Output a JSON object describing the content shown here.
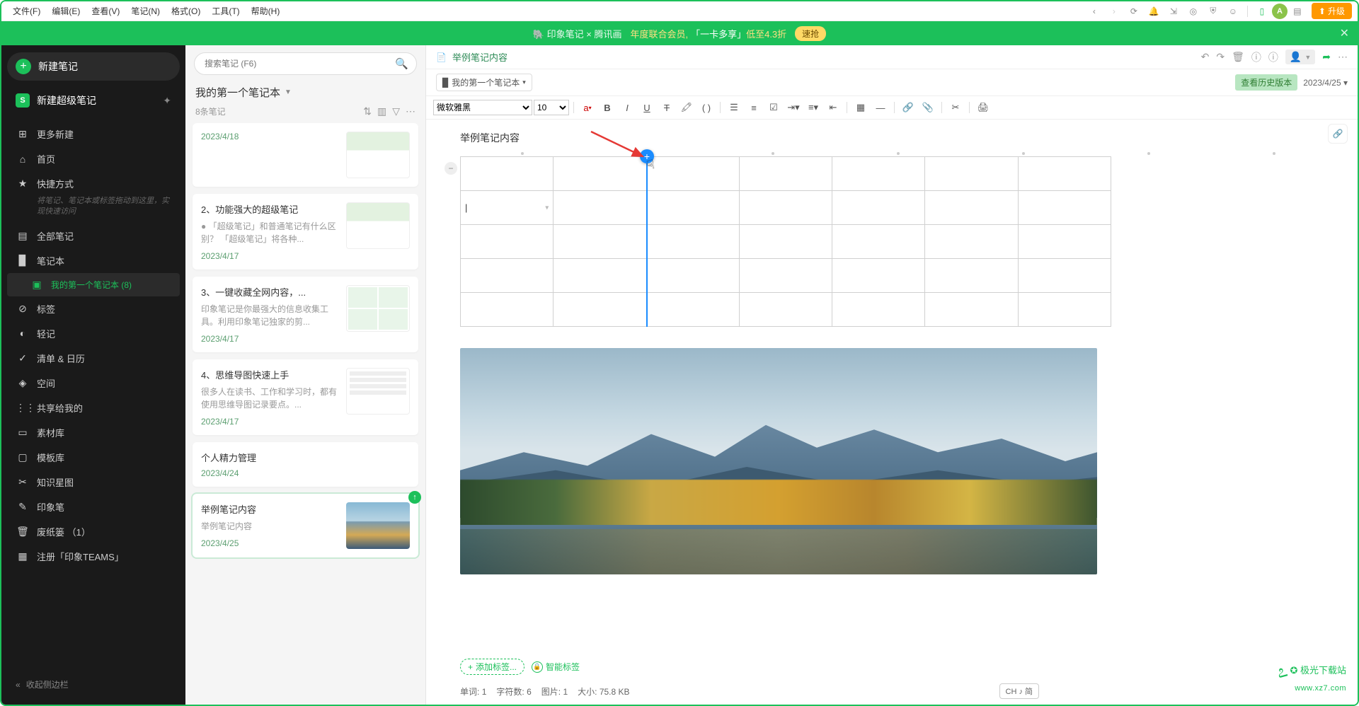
{
  "menubar": {
    "items": [
      "文件(F)",
      "编辑(E)",
      "查看(V)",
      "笔记(N)",
      "格式(O)",
      "工具(T)",
      "帮助(H)"
    ],
    "avatar_letter": "A",
    "upgrade_label": "升级"
  },
  "banner": {
    "logo_text": "印象笔记 × 腾讯画",
    "text1": "年度联合会员,",
    "text2": "「一卡多享」",
    "text3": "低至4.3折",
    "grab_label": "速抢"
  },
  "sidebar": {
    "new_note": "新建笔记",
    "new_super": "新建超级笔记",
    "items": [
      {
        "icon": "⊞",
        "label": "更多新建"
      },
      {
        "icon": "⌂",
        "label": "首页"
      },
      {
        "icon": "★",
        "label": "快捷方式",
        "subtext": "将笔记、笔记本或标签拖动到这里，实现快速访问"
      },
      {
        "icon": "▤",
        "label": "全部笔记"
      },
      {
        "icon": "▉",
        "label": "笔记本"
      },
      {
        "icon": "▣",
        "label": "我的第一个笔记本  (8)",
        "indent": true,
        "active": true
      },
      {
        "icon": "⊘",
        "label": "标签"
      },
      {
        "icon": "◐",
        "label": "轻记"
      },
      {
        "icon": "✓",
        "label": "清单 & 日历"
      },
      {
        "icon": "◈",
        "label": "空间"
      },
      {
        "icon": "⋮⋮",
        "label": "共享给我的"
      },
      {
        "icon": "▭",
        "label": "素材库"
      },
      {
        "icon": "▢",
        "label": "模板库"
      },
      {
        "icon": "✂",
        "label": "知识星图"
      },
      {
        "icon": "✎",
        "label": "印象笔"
      },
      {
        "icon": "🗑",
        "label": "废纸篓 （1）"
      },
      {
        "icon": "▦",
        "label": "注册「印象TEAMS」"
      }
    ],
    "collapse": "收起侧边栏"
  },
  "notelist": {
    "search_placeholder": "搜索笔记 (F6)",
    "notebook_title": "我的第一个笔记本",
    "count_label": "8条笔记",
    "cards": [
      {
        "title": "",
        "snippet": "",
        "date": "2023/4/18",
        "thumb": "app"
      },
      {
        "title": "2、功能强大的超级笔记",
        "snippet": "● 「超级笔记」和普通笔记有什么区别？ 「超级笔记」将各种...",
        "date": "2023/4/17",
        "thumb": "app"
      },
      {
        "title": "3、一键收藏全网内容，...",
        "snippet": "印象笔记是你最强大的信息收集工具。利用印象笔记独家的剪...",
        "date": "2023/4/17",
        "thumb": "grid"
      },
      {
        "title": "4、思维导图快速上手",
        "snippet": "很多人在读书、工作和学习时，都有使用思维导图记录要点。...",
        "date": "2023/4/17",
        "thumb": "list"
      },
      {
        "title": "个人精力管理",
        "snippet": "",
        "date": "2023/4/24",
        "thumb": ""
      },
      {
        "title": "举例笔记内容",
        "snippet": "举例笔记内容",
        "date": "2023/4/25",
        "thumb": "landscape",
        "selected": true,
        "syncing": true
      }
    ]
  },
  "editor": {
    "breadcrumb_title": "举例笔记内容",
    "notebook_pill": "我的第一个笔记本",
    "history_btn": "查看历史版本",
    "date": "2023/4/25",
    "font_name": "微软雅黑",
    "font_size": "10",
    "doc_title": "举例笔记内容",
    "table_cell_value": "",
    "tag_add": "添加标签...",
    "smart_tag": "智能标签",
    "status": {
      "words_label": "单词:",
      "words": "1",
      "chars_label": "字符数:",
      "chars": "6",
      "images_label": "图片:",
      "images": "1",
      "size_label": "大小:",
      "size": "75.8 KB"
    },
    "ime": "CH ♪ 简"
  },
  "watermark": {
    "line1": "✪ 极光下载站",
    "line2": "www.xz7.com"
  }
}
